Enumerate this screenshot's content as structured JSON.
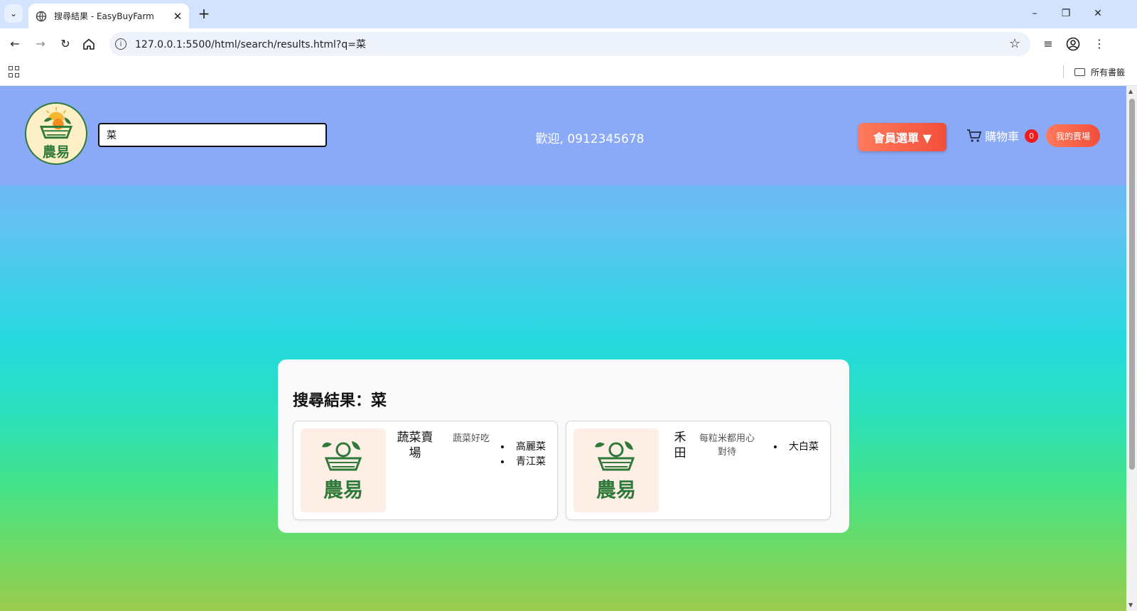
{
  "browser": {
    "tab_title": "搜尋結果 - EasyBuyFarm",
    "url": "127.0.0.1:5500/html/search/results.html?q=菜",
    "bookmarks_folder": "所有書籤",
    "icons": [
      "tab-search-icon",
      "globe-icon",
      "close-icon",
      "plus-icon",
      "minimize-icon",
      "restore-icon",
      "window-close-icon",
      "back-icon",
      "forward-icon",
      "reload-icon",
      "home-icon",
      "info-icon",
      "star-icon",
      "media-icon",
      "profile-icon",
      "more-icon",
      "apps-icon",
      "folder-icon"
    ]
  },
  "header": {
    "logo_text": "農易",
    "search_value": "菜",
    "welcome": "歡迎, 0912345678",
    "member_menu": "會員選單 ▼",
    "cart_label": "購物車",
    "cart_count": "0",
    "my_shop": "我的賣場"
  },
  "results": {
    "title": "搜尋結果：菜",
    "cards": [
      {
        "name": "蔬菜賣場",
        "desc": "蔬菜好吃",
        "logo_text": "農易",
        "items": [
          "高麗菜",
          "青江菜"
        ]
      },
      {
        "name": "禾田",
        "desc": "每粒米都用心對待",
        "logo_text": "農易",
        "items": [
          "大白菜"
        ]
      }
    ]
  },
  "colors": {
    "header_bg": "#8aaaf8",
    "accent_orange": "#f24e3a",
    "badge_red": "#ee1c1c",
    "logo_green": "#2f7a39"
  }
}
